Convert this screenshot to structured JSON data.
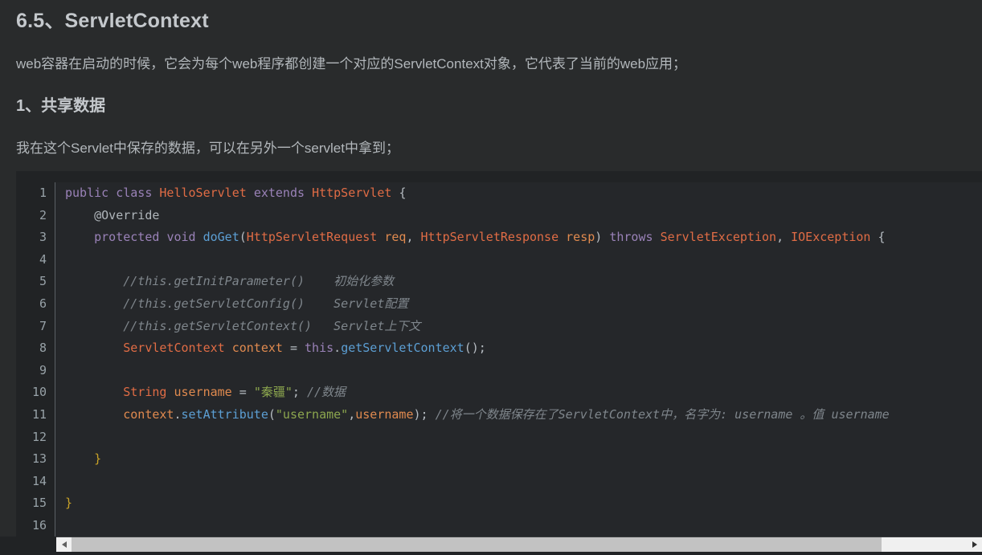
{
  "article": {
    "heading": "6.5、ServletContext",
    "intro": "web容器在启动的时候，它会为每个web程序都创建一个对应的ServletContext对象，它代表了当前的web应用；",
    "subheading": "1、共享数据",
    "subintro": "我在这个Servlet中保存的数据，可以在另外一个servlet中拿到；"
  },
  "code": {
    "language": "java",
    "line_numbers": [
      "1",
      "2",
      "3",
      "4",
      "5",
      "6",
      "7",
      "8",
      "9",
      "10",
      "11",
      "12",
      "13",
      "14",
      "15",
      "16"
    ],
    "lines": [
      "public class HelloServlet extends HttpServlet {",
      "    @Override",
      "    protected void doGet(HttpServletRequest req, HttpServletResponse resp) throws ServletException, IOException {",
      "",
      "        //this.getInitParameter()    初始化参数",
      "        //this.getServletConfig()    Servlet配置",
      "        //this.getServletContext()   Servlet上下文",
      "        ServletContext context = this.getServletContext();",
      "",
      "        String username = \"秦疆\"; //数据",
      "        context.setAttribute(\"username\",username); //将一个数据保存在了ServletContext中，名字为: username 。值 username",
      "",
      "    }",
      "",
      "}",
      ""
    ],
    "tokens": {
      "l1": [
        {
          "t": "public ",
          "c": "kw"
        },
        {
          "t": "class ",
          "c": "kw"
        },
        {
          "t": "HelloServlet ",
          "c": "type"
        },
        {
          "t": "extends ",
          "c": "kw"
        },
        {
          "t": "HttpServlet ",
          "c": "type"
        },
        {
          "t": "{",
          "c": "punc"
        }
      ],
      "l2": [
        {
          "t": "    @Override",
          "c": "anno"
        }
      ],
      "l3": [
        {
          "t": "    ",
          "c": "punc"
        },
        {
          "t": "protected ",
          "c": "kw"
        },
        {
          "t": "void ",
          "c": "kw"
        },
        {
          "t": "doGet",
          "c": "fn"
        },
        {
          "t": "(",
          "c": "punc"
        },
        {
          "t": "HttpServletRequest ",
          "c": "type"
        },
        {
          "t": "req",
          "c": "ident"
        },
        {
          "t": ", ",
          "c": "punc"
        },
        {
          "t": "HttpServletResponse ",
          "c": "type"
        },
        {
          "t": "resp",
          "c": "ident"
        },
        {
          "t": ") ",
          "c": "punc"
        },
        {
          "t": "throws ",
          "c": "kw"
        },
        {
          "t": "ServletException",
          "c": "type"
        },
        {
          "t": ", ",
          "c": "punc"
        },
        {
          "t": "IOException ",
          "c": "type"
        },
        {
          "t": "{",
          "c": "punc"
        }
      ],
      "l5": [
        {
          "t": "        //this.getInitParameter()    初始化参数",
          "c": "cmt"
        }
      ],
      "l6": [
        {
          "t": "        //this.getServletConfig()    Servlet配置",
          "c": "cmt"
        }
      ],
      "l7": [
        {
          "t": "        //this.getServletContext()   Servlet上下文",
          "c": "cmt"
        }
      ],
      "l8": [
        {
          "t": "        ",
          "c": "punc"
        },
        {
          "t": "ServletContext ",
          "c": "type"
        },
        {
          "t": "context ",
          "c": "ident"
        },
        {
          "t": "= ",
          "c": "punc"
        },
        {
          "t": "this",
          "c": "kw"
        },
        {
          "t": ".",
          "c": "punc"
        },
        {
          "t": "getServletContext",
          "c": "fn"
        },
        {
          "t": "();",
          "c": "punc"
        }
      ],
      "l10": [
        {
          "t": "        ",
          "c": "punc"
        },
        {
          "t": "String ",
          "c": "type"
        },
        {
          "t": "username ",
          "c": "ident"
        },
        {
          "t": "= ",
          "c": "punc"
        },
        {
          "t": "\"秦疆\"",
          "c": "str"
        },
        {
          "t": "; ",
          "c": "punc"
        },
        {
          "t": "//数据",
          "c": "cmt"
        }
      ],
      "l11": [
        {
          "t": "        ",
          "c": "punc"
        },
        {
          "t": "context",
          "c": "ident"
        },
        {
          "t": ".",
          "c": "punc"
        },
        {
          "t": "setAttribute",
          "c": "fn"
        },
        {
          "t": "(",
          "c": "punc"
        },
        {
          "t": "\"username\"",
          "c": "str"
        },
        {
          "t": ",",
          "c": "punc"
        },
        {
          "t": "username",
          "c": "ident"
        },
        {
          "t": "); ",
          "c": "punc"
        },
        {
          "t": "//将一个数据保存在了ServletContext中，名字为: username 。值 username",
          "c": "cmt"
        }
      ],
      "l13": [
        {
          "t": "    ",
          "c": "punc"
        },
        {
          "t": "}",
          "c": "brace"
        }
      ],
      "l15": [
        {
          "t": "}",
          "c": "brace"
        }
      ]
    }
  },
  "scrollbar": {
    "left_arrow": "scroll-left",
    "right_arrow": "scroll-right",
    "thumb_fraction": 0.905
  },
  "colors": {
    "background": "#292b2c",
    "code_background": "#25272a",
    "gutter_background": "#212325",
    "keyword": "#9a82b8",
    "type": "#e06c45",
    "identifier": "#e08a4f",
    "function": "#5c9fd4",
    "string": "#8ca64e",
    "comment": "#7f868c",
    "text": "#b2b7bb"
  }
}
